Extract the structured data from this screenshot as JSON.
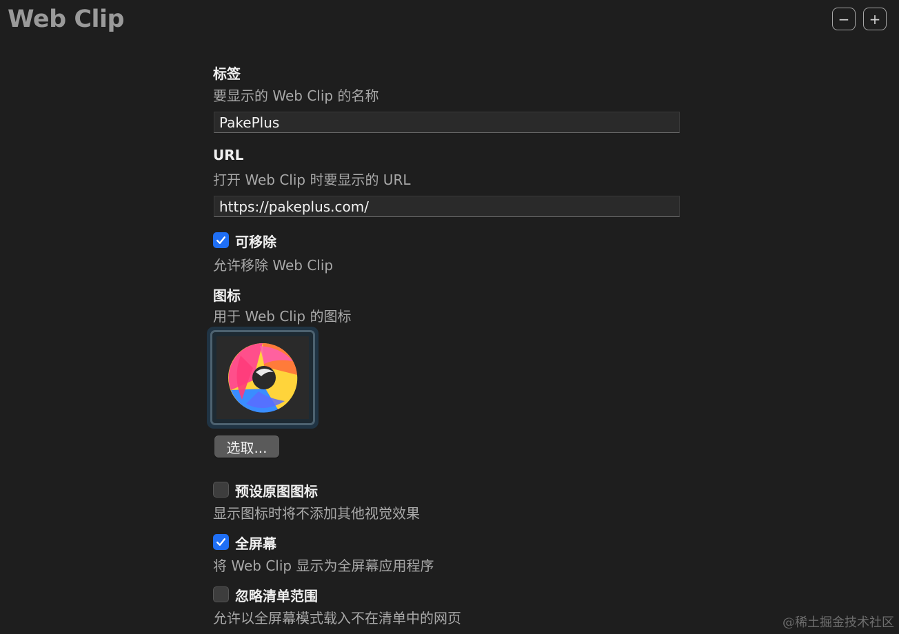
{
  "header": {
    "title": "Web Clip",
    "minus_label": "−",
    "plus_label": "+"
  },
  "label_section": {
    "title": "标签",
    "description": "要显示的 Web Clip 的名称",
    "value": "PakePlus"
  },
  "url_section": {
    "title": "URL",
    "description": "打开 Web Clip 时要显示的 URL",
    "value": "https://pakeplus.com/"
  },
  "removable": {
    "label": "可移除",
    "description": "允许移除 Web Clip",
    "checked": true
  },
  "icon_section": {
    "title": "图标",
    "description": "用于 Web Clip 的图标",
    "choose_label": "选取..."
  },
  "precomposed": {
    "label": "预设原图图标",
    "description": "显示图标时将不添加其他视觉效果",
    "checked": false
  },
  "fullscreen": {
    "label": "全屏幕",
    "description": "将 Web Clip 显示为全屏幕应用程序",
    "checked": true
  },
  "ignore_manifest": {
    "label": "忽略清单范围",
    "description": "允许以全屏幕模式载入不在清单中的网页",
    "checked": false
  },
  "watermark": "@稀土掘金技术社区",
  "colors": {
    "checkbox_on": "#1f6ff5",
    "background": "#1e1e1e"
  }
}
